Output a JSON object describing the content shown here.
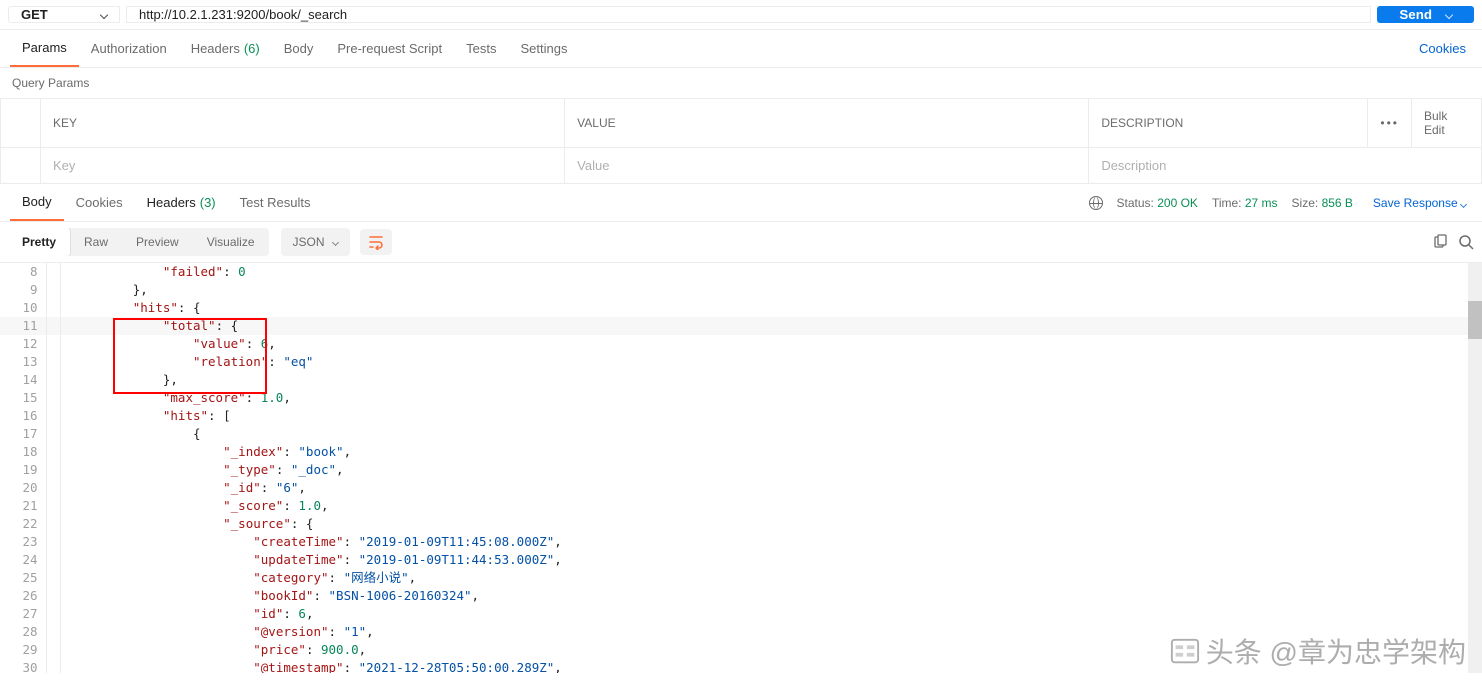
{
  "request": {
    "method": "GET",
    "url": "http://10.2.1.231:9200/book/_search",
    "send_label": "Send"
  },
  "tabs": {
    "params": "Params",
    "authorization": "Authorization",
    "headers": "Headers",
    "headers_count": "(6)",
    "body": "Body",
    "prerequest": "Pre-request Script",
    "tests": "Tests",
    "settings": "Settings",
    "cookies_link": "Cookies"
  },
  "query_params": {
    "title": "Query Params",
    "header_key": "KEY",
    "header_value": "VALUE",
    "header_description": "DESCRIPTION",
    "bulk_edit": "Bulk Edit",
    "ph_key": "Key",
    "ph_value": "Value",
    "ph_description": "Description"
  },
  "resp_tabs": {
    "body": "Body",
    "cookies": "Cookies",
    "headers": "Headers",
    "headers_count": "(3)",
    "test_results": "Test Results"
  },
  "status": {
    "status_label": "Status:",
    "status_value": "200 OK",
    "time_label": "Time:",
    "time_value": "27 ms",
    "size_label": "Size:",
    "size_value": "856 B",
    "save_response": "Save Response"
  },
  "view": {
    "pretty": "Pretty",
    "raw": "Raw",
    "preview": "Preview",
    "visualize": "Visualize",
    "format": "JSON"
  },
  "code": {
    "l8": "            \"failed\": 0",
    "l9": "        },",
    "l10": "        \"hits\": {",
    "l11": "            \"total\": {",
    "l12": "                \"value\": 6,",
    "l13": "                \"relation\": \"eq\"",
    "l14": "            },",
    "l15": "            \"max_score\": 1.0,",
    "l16": "            \"hits\": [",
    "l17": "                {",
    "l18": "                    \"_index\": \"book\",",
    "l19": "                    \"_type\": \"_doc\",",
    "l20": "                    \"_id\": \"6\",",
    "l21": "                    \"_score\": 1.0,",
    "l22": "                    \"_source\": {",
    "l23": "                        \"createTime\": \"2019-01-09T11:45:08.000Z\",",
    "l24": "                        \"updateTime\": \"2019-01-09T11:44:53.000Z\",",
    "l25": "                        \"category\": \"网络小说\",",
    "l26": "                        \"bookId\": \"BSN-1006-20160324\",",
    "l27": "                        \"id\": 6,",
    "l28": "                        \"@version\": \"1\",",
    "l29": "                        \"price\": 900.0,",
    "l30": "                        \"@timestamp\": \"2021-12-28T05:50:00.289Z\","
  },
  "watermark": "头条 @章为忠学架构"
}
